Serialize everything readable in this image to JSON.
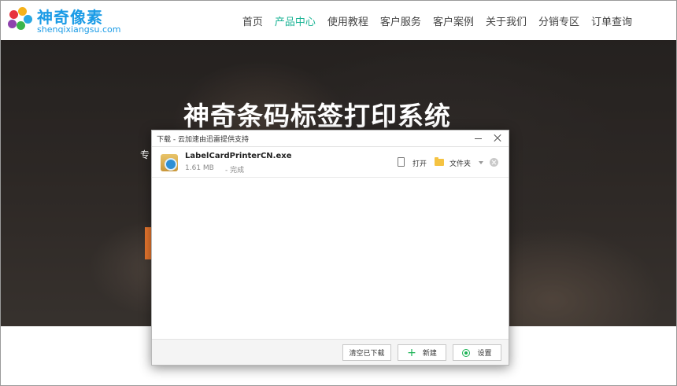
{
  "header": {
    "brand_name": "神奇像素",
    "brand_url": "shenqixiangsu.com",
    "nav": [
      "首页",
      "产品中心",
      "使用教程",
      "客户服务",
      "客户案例",
      "关于我们",
      "分销专区",
      "订单查询"
    ],
    "active_nav": "产品中心",
    "accent_color": "#1ab394"
  },
  "hero": {
    "title": "神奇条码标签打印系统",
    "subtitle_visible": "专"
  },
  "dialog": {
    "title": "下载 - 云加速由迅雷提供支持",
    "download": {
      "file_name": "LabelCardPrinterCN.exe",
      "size": "1.61 MB",
      "status": "- 完成",
      "open_label": "打开",
      "folder_label": "文件夹"
    },
    "footer": {
      "clear_label": "清空已下载",
      "new_label": "新建",
      "settings_label": "设置"
    }
  }
}
